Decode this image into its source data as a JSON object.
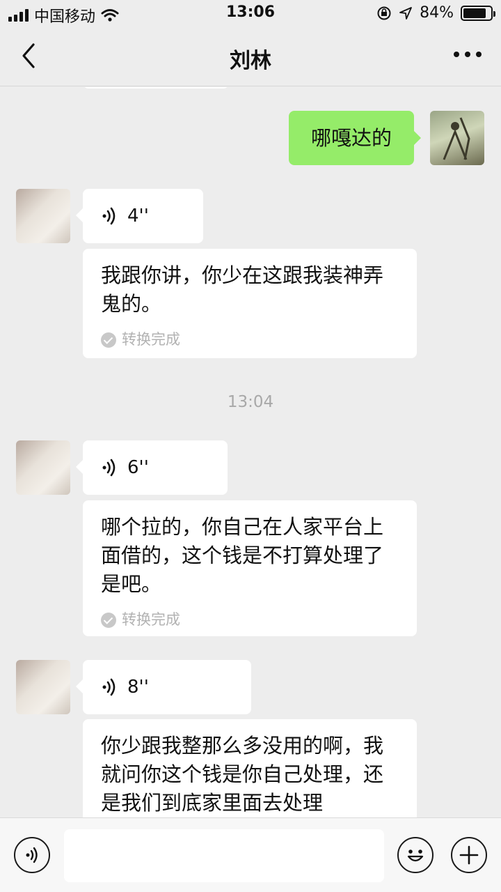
{
  "status_bar": {
    "carrier": "中国移动",
    "time": "13:06",
    "battery": "84%",
    "battery_level": 0.84
  },
  "header": {
    "title": "刘林"
  },
  "messages": [
    {
      "side": "right",
      "type": "text",
      "text": "哪嘎达的"
    },
    {
      "side": "left",
      "type": "voice",
      "duration": "4''",
      "transcript": "我跟你讲，你少在这跟我装神弄鬼的。",
      "status": "转换完成"
    },
    {
      "side": "left",
      "type": "voice",
      "duration": "6''",
      "transcript": "哪个拉的，你自己在人家平台上面借的，这个钱是不打算处理了是吧。",
      "status": "转换完成"
    },
    {
      "side": "left",
      "type": "voice",
      "duration": "8''",
      "transcript": "你少跟我整那么多没用的啊，我就问你这个钱是你自己处理，还是我们到底家里面去处理"
    }
  ],
  "time_divider": "13:04",
  "input": {
    "placeholder": ""
  },
  "icons": [
    "back-icon",
    "more-icon",
    "voice-wave-icon",
    "voice-input-icon",
    "emoji-icon",
    "plus-icon",
    "wifi-icon",
    "location-icon",
    "rotation-lock-icon",
    "battery-icon",
    "signal-icon"
  ]
}
